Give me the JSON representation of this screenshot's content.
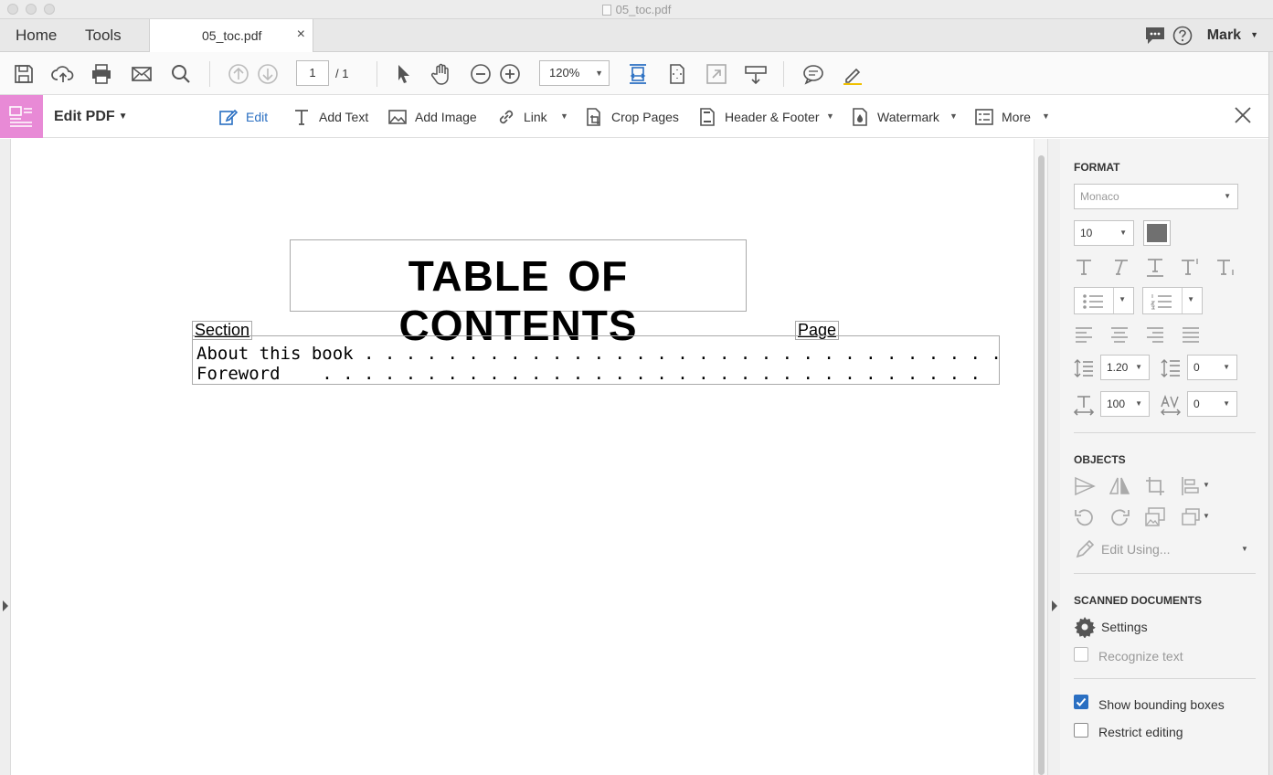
{
  "window": {
    "title": "05_toc.pdf"
  },
  "tabs": {
    "home": "Home",
    "tools": "Tools",
    "document": "05_toc.pdf",
    "close_glyph": "×",
    "user": "Mark"
  },
  "toolbar": {
    "page_current": "1",
    "page_total": "/ 1",
    "zoom": "120%"
  },
  "edit_bar": {
    "title": "Edit PDF",
    "tools": {
      "edit": "Edit",
      "add_text": "Add Text",
      "add_image": "Add Image",
      "link": "Link",
      "crop_pages": "Crop Pages",
      "header_footer": "Header & Footer",
      "watermark": "Watermark",
      "more": "More"
    },
    "accent_color": "#e88ad6",
    "active_color": "#2a6fc2"
  },
  "document": {
    "title": "TABLE OF CONTENTS",
    "section_header": "Section",
    "page_header": "Page",
    "rows": [
      "About this book . . . . . . . . . . . . . . . . . . . . . . . . . . . . . . .",
      "Foreword    . . . . . . . . . . . . . . . . . . . . . . . . . . . . . . . ."
    ]
  },
  "format_panel": {
    "heading": "FORMAT",
    "font": "Monaco",
    "font_size": "10",
    "line_spacing": "1.20",
    "paragraph_spacing": "0",
    "horizontal_scaling": "100",
    "character_spacing": "0",
    "text_color": "#707070"
  },
  "objects_panel": {
    "heading": "OBJECTS",
    "edit_using": "Edit Using..."
  },
  "scanned_panel": {
    "heading": "SCANNED DOCUMENTS",
    "settings": "Settings",
    "recognize_text": "Recognize text",
    "show_bounding_boxes": "Show bounding boxes",
    "restrict_editing": "Restrict editing",
    "show_bounding_boxes_checked": true,
    "restrict_editing_checked": false
  }
}
